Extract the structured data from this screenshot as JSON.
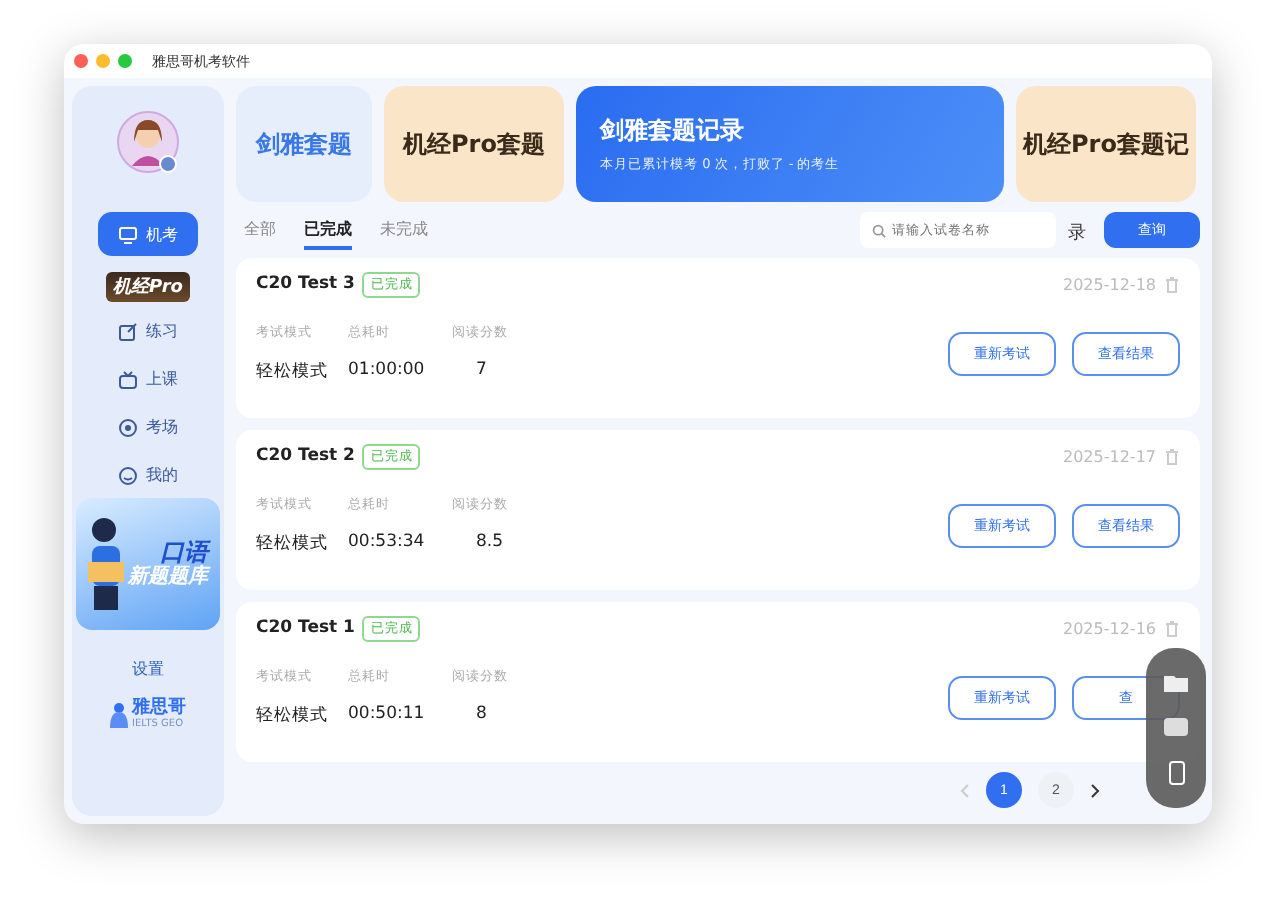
{
  "window": {
    "title": "雅思哥机考软件"
  },
  "sidebar": {
    "items": [
      {
        "label": "机考",
        "selected": true
      },
      {
        "label": "练习",
        "selected": false
      },
      {
        "label": "上课",
        "selected": false
      },
      {
        "label": "考场",
        "selected": false
      },
      {
        "label": "我的",
        "selected": false
      }
    ],
    "pro_logo": "机经Pro",
    "banner": {
      "line_1": "口语",
      "line_2": "新题题库"
    },
    "settings": "设置",
    "brand": {
      "name": "雅思哥",
      "sub": "IELTS GEO"
    }
  },
  "header_cards": [
    {
      "kind": "plain",
      "title": "剑雅套题",
      "color": "#e6eefc"
    },
    {
      "kind": "plain",
      "title": "机经Pro套题",
      "color": "#fbe5c8"
    },
    {
      "kind": "hero",
      "title": "剑雅套题记录",
      "subtitle": "本月已累计模考 0 次，打败了 - 的考生"
    },
    {
      "kind": "plain",
      "title": "机经Pro套题记",
      "color": "#fbe5c8",
      "overflow": "录"
    }
  ],
  "tabs": [
    {
      "label": "全部",
      "selected": false
    },
    {
      "label": "已完成",
      "selected": true
    },
    {
      "label": "未完成",
      "selected": false
    }
  ],
  "search": {
    "placeholder": "请输入试卷名称",
    "button": "查询"
  },
  "records": [
    {
      "title": "C20 Test 3",
      "status": "已完成",
      "date": "2025-12-18",
      "labels": [
        "考试模式",
        "总耗时",
        "阅读分数"
      ],
      "values": [
        "轻松模式",
        "01:00:00",
        "7"
      ],
      "actions": [
        "重新考试",
        "查看结果"
      ]
    },
    {
      "title": "C20 Test 2",
      "status": "已完成",
      "date": "2025-12-17",
      "labels": [
        "考试模式",
        "总耗时",
        "阅读分数"
      ],
      "values": [
        "轻松模式",
        "00:53:34",
        "8.5"
      ],
      "actions": [
        "重新考试",
        "查看结果"
      ]
    },
    {
      "title": "C20 Test 1",
      "status": "已完成",
      "date": "2025-12-16",
      "labels": [
        "考试模式",
        "总耗时",
        "阅读分数"
      ],
      "values": [
        "轻松模式",
        "00:50:11",
        "8"
      ],
      "actions": [
        "重新考试",
        "查"
      ]
    }
  ],
  "pagination": {
    "pages": [
      {
        "label": "1",
        "selected": true
      },
      {
        "label": "2",
        "selected": false
      }
    ]
  }
}
